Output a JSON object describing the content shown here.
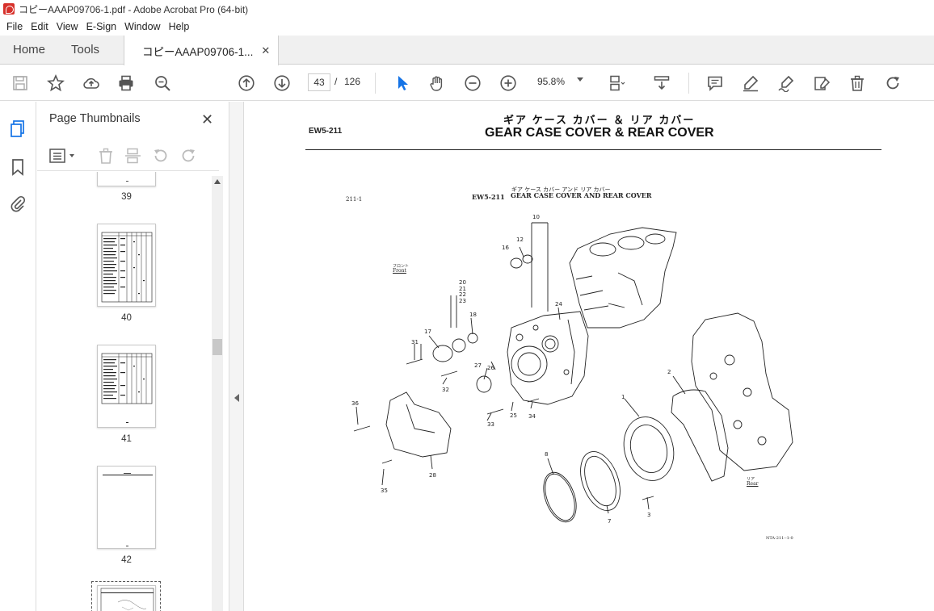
{
  "window": {
    "title": "コピーAAAP09706-1.pdf - Adobe Acrobat Pro (64-bit)"
  },
  "menu": [
    "File",
    "Edit",
    "View",
    "E-Sign",
    "Window",
    "Help"
  ],
  "tabs": {
    "home": "Home",
    "tools": "Tools",
    "document": "コピーAAAP09706-1..."
  },
  "nav": {
    "current_page": "43",
    "separator": "/",
    "total_pages": "126",
    "zoom": "95.8%"
  },
  "panel": {
    "title": "Page Thumbnails",
    "thumbnails": [
      {
        "label": "39"
      },
      {
        "label": "40"
      },
      {
        "label": "41"
      },
      {
        "label": "42"
      }
    ]
  },
  "document": {
    "section_code": "EW5-211",
    "title_jp": "ギア ケース カバー ＆ リア カバー",
    "title_en": "GEAR CASE COVER & REAR COVER",
    "figure": {
      "page_ref": "211-1",
      "code": "EW5-211",
      "caption_jp": "ギア ケース カバー アンド リア カバー",
      "caption_en": "GEAR CASE COVER AND REAR COVER",
      "front_jp": "フロント",
      "front_en": "Front",
      "rear_jp": "リア",
      "rear_en": "Rear",
      "drawing_no": "NTA-211--1-0",
      "callouts": [
        "10",
        "12",
        "16",
        "20",
        "21",
        "22",
        "23",
        "18",
        "17",
        "31",
        "24",
        "27",
        "26",
        "32",
        "33",
        "25",
        "34",
        "36",
        "28",
        "35",
        "2",
        "1",
        "8",
        "7",
        "3"
      ]
    }
  },
  "colors": {
    "accent": "#1473e6",
    "icon": "#555555",
    "titlebar_icon": "#d7312b"
  }
}
